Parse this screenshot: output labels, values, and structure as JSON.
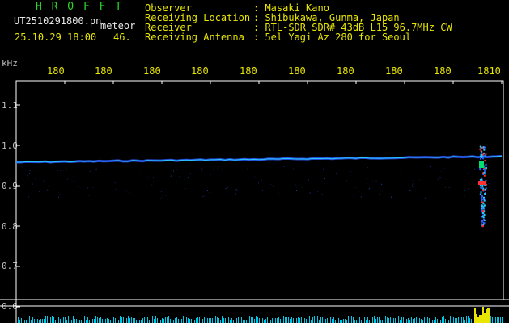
{
  "title_logo": "H R O F F T",
  "filename": "UT2510291800.pn",
  "event_label": "meteor",
  "datetime": "25.10.29 18:00",
  "event_count": "46.",
  "header": {
    "observer_label": "Observer",
    "observer_value": ": Masaki Kano",
    "location_label": "Receiving Location",
    "location_value": ": Shibukawa, Gunma, Japan",
    "receiver_label": "Receiver",
    "receiver_value": ": RTL-SDR SDR# 43dB L15 96.7MHz CW",
    "antenna_label": "Receiving Antenna",
    "antenna_value": ": 5el Yagi Az 280 for Seoul"
  },
  "y_axis": {
    "unit": "kHz",
    "ticks": [
      "1.1",
      "1.0",
      "0.9",
      "0.8",
      "0.7",
      "0.6"
    ]
  },
  "time_ticks": [
    "180",
    "180",
    "180",
    "180",
    "180",
    "180",
    "180",
    "180",
    "180",
    "1810"
  ],
  "colors": {
    "background": "#000000",
    "signal_blue": "#2a5cff",
    "signal_cyan": "#29c8ff",
    "meteor_red": "#ff3030",
    "count_bar": "#00c8e6",
    "count_yellow": "#e8e600",
    "text_yellow": "#e8e600",
    "text_green": "#29d629"
  }
}
